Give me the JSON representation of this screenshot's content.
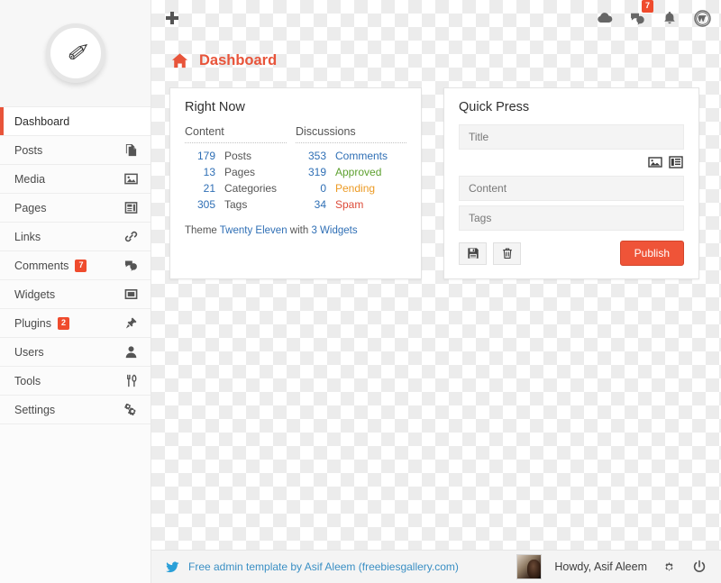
{
  "brand": {
    "logo_glyph": "✐"
  },
  "topbar": {
    "add_label": "+",
    "icons": [
      {
        "name": "cloud-icon",
        "badge": null
      },
      {
        "name": "comments-icon",
        "badge": "7"
      },
      {
        "name": "bell-icon",
        "badge": null
      },
      {
        "name": "wordpress-icon",
        "badge": null
      }
    ],
    "comments_badge": "7"
  },
  "sidebar": {
    "items": [
      {
        "label": "Dashboard",
        "icon": "",
        "badge": null,
        "active": true
      },
      {
        "label": "Posts",
        "icon": "posts-icon",
        "badge": null,
        "active": false
      },
      {
        "label": "Media",
        "icon": "media-icon",
        "badge": null,
        "active": false
      },
      {
        "label": "Pages",
        "icon": "pages-icon",
        "badge": null,
        "active": false
      },
      {
        "label": "Links",
        "icon": "links-icon",
        "badge": null,
        "active": false
      },
      {
        "label": "Comments",
        "icon": "comments-icon",
        "badge": "7",
        "active": false
      },
      {
        "label": "Widgets",
        "icon": "widgets-icon",
        "badge": null,
        "active": false
      },
      {
        "label": "Plugins",
        "icon": "plugins-icon",
        "badge": "2",
        "active": false
      },
      {
        "label": "Users",
        "icon": "users-icon",
        "badge": null,
        "active": false
      },
      {
        "label": "Tools",
        "icon": "tools-icon",
        "badge": null,
        "active": false
      },
      {
        "label": "Settings",
        "icon": "settings-icon",
        "badge": null,
        "active": false
      }
    ]
  },
  "page": {
    "title": "Dashboard"
  },
  "right_now": {
    "title": "Right Now",
    "content_header": "Content",
    "discussions_header": "Discussions",
    "content": [
      {
        "count": "179",
        "label": "Posts"
      },
      {
        "count": "13",
        "label": "Pages"
      },
      {
        "count": "21",
        "label": "Categories"
      },
      {
        "count": "305",
        "label": "Tags"
      }
    ],
    "discussions": [
      {
        "count": "353",
        "label": "Comments",
        "color": "link"
      },
      {
        "count": "319",
        "label": "Approved",
        "color": "green"
      },
      {
        "count": "0",
        "label": "Pending",
        "color": "orange"
      },
      {
        "count": "34",
        "label": "Spam",
        "color": "red"
      }
    ],
    "theme_prefix": "Theme",
    "theme_name": "Twenty Eleven",
    "theme_middle": "with",
    "theme_widgets": "3 Widgets"
  },
  "quick_press": {
    "title": "Quick Press",
    "title_placeholder": "Title",
    "content_placeholder": "Content",
    "tags_placeholder": "Tags",
    "save_draft_label": "",
    "reset_label": "",
    "publish_label": "Publish"
  },
  "footer": {
    "credit": "Free admin template by Asif Aleem (freebiesgallery.com)",
    "howdy": "Howdy, Asif Aleem"
  },
  "colors": {
    "accent_red": "#e8543a",
    "badge_red": "#ef4b2d",
    "link_blue": "#2f6fb5",
    "green": "#5da02f",
    "orange": "#ec9a23",
    "red": "#dd4b39",
    "footer_link": "#3a8fc4"
  }
}
